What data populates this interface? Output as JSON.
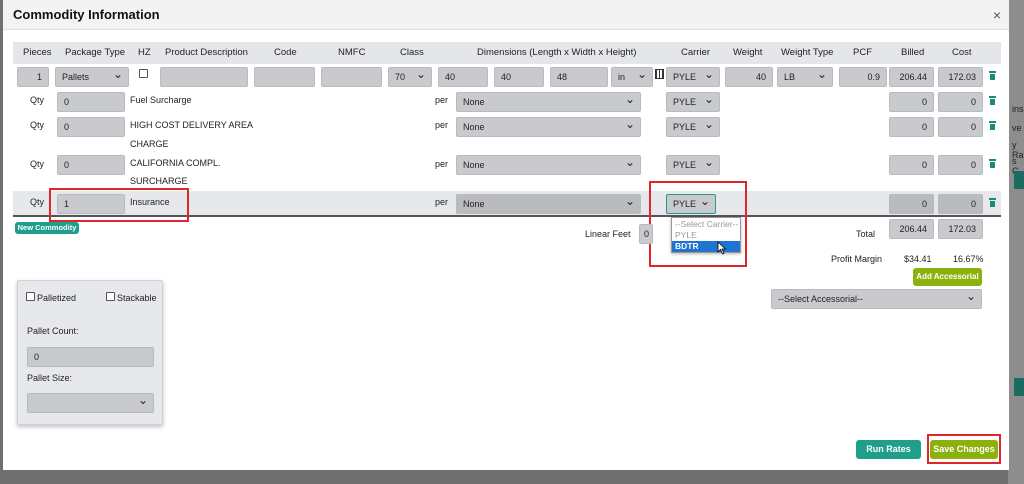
{
  "modal": {
    "title": "Commodity Information",
    "close": "×"
  },
  "table": {
    "headers": [
      "Pieces",
      "Package Type",
      "HZ",
      "Product Description",
      "Code",
      "NMFC",
      "Class",
      "Dimensions (Length x Width x Height)",
      "Carrier",
      "Weight",
      "Weight Type",
      "PCF",
      "Billed",
      "Cost"
    ]
  },
  "commodity": {
    "pieces": "1",
    "package_type": "Pallets",
    "class": "70",
    "length": "40",
    "width": "40",
    "height": "48",
    "dim_unit": "in",
    "carrier": "PYLE",
    "weight": "40",
    "weight_type": "LB",
    "pcf": "0.9",
    "billed": "206.44",
    "cost": "172.03"
  },
  "accessorials": [
    {
      "qty_label": "Qty",
      "qty": "0",
      "desc": "Fuel Surcharge",
      "desc2": "",
      "per": "per",
      "per_value": "None",
      "carrier": "PYLE",
      "billed": "0",
      "cost": "0"
    },
    {
      "qty_label": "Qty",
      "qty": "0",
      "desc": "HIGH COST DELIVERY AREA",
      "desc2": "CHARGE",
      "per": "per",
      "per_value": "None",
      "carrier": "PYLE",
      "billed": "0",
      "cost": "0"
    },
    {
      "qty_label": "Qty",
      "qty": "0",
      "desc": "CALIFORNIA COMPL.",
      "desc2": "SURCHARGE",
      "per": "per",
      "per_value": "None",
      "carrier": "PYLE",
      "billed": "0",
      "cost": "0"
    },
    {
      "qty_label": "Qty",
      "qty": "1",
      "desc": "Insurance",
      "desc2": "",
      "per": "per",
      "per_value": "None",
      "carrier": "PYLE",
      "billed": "0",
      "cost": "0"
    }
  ],
  "carrier_dropdown": {
    "options": [
      "--Select Carrier--",
      "PYLE",
      "BDTR"
    ],
    "highlighted": "BDTR"
  },
  "new_commodity_label": "New Commodity",
  "linear_feet": {
    "label": "Linear Feet",
    "value": "0"
  },
  "totals": {
    "total_label": "Total",
    "billed": "206.44",
    "cost": "172.03",
    "profit_margin_label": "Profit Margin",
    "profit_amount": "$34.41",
    "profit_percent": "16.67%"
  },
  "add_accessorial_label": "Add Accessorial",
  "select_accessorial": "--Select Accessorial--",
  "pallet_panel": {
    "palletized_label": "Palletized",
    "stackable_label": "Stackable",
    "pallet_count_label": "Pallet Count:",
    "pallet_count": "0",
    "pallet_size_label": "Pallet Size:",
    "pallet_size": ""
  },
  "run_rates_label": "Run Rates",
  "save_changes_label": "Save Changes",
  "background_snippets": [
    "ins",
    "ve",
    "y Ra",
    "s C",
    "C"
  ],
  "colors": {
    "teal": "#1f9e8c",
    "green": "#8cb10c",
    "highlight": "#e0262b",
    "selected": "#1e74d0"
  }
}
